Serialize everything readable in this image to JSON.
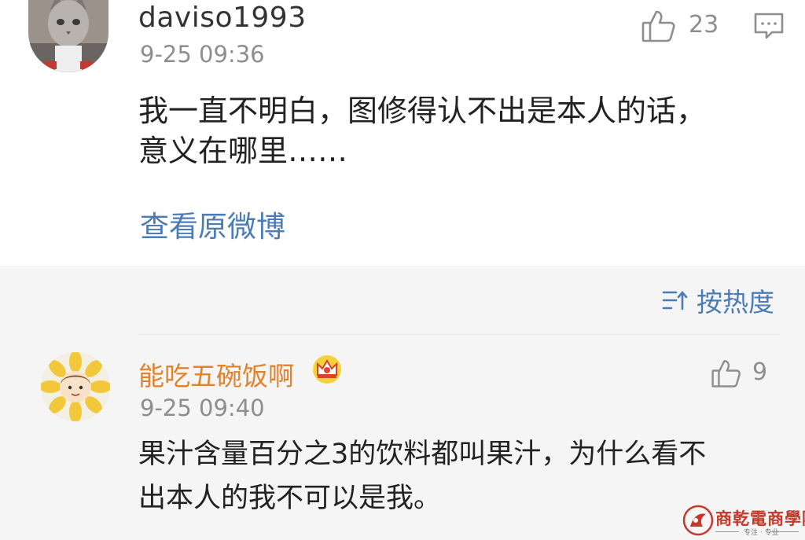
{
  "comment1": {
    "username": "daviso1993",
    "time": "9-25 09:36",
    "like_count": "23",
    "text_line1": "我一直不明白，图修得认不出是本人的话，",
    "text_line2": "意义在哪里……",
    "view_original": "查看原微博"
  },
  "sort": {
    "label": "按热度"
  },
  "comment2": {
    "username": "能吃五碗饭啊",
    "time": "9-25 09:40",
    "like_count": "9",
    "text_line1": "果汁含量百分之3的饮料都叫果汁，为什么看不",
    "text_line2": "出本人的我不可以是我。"
  },
  "watermark": {
    "title": "商乾電商學院",
    "subtitle": "专注 · 专业"
  },
  "colors": {
    "link": "#4c7cb5",
    "vip_name": "#e0832c",
    "meta": "#8e8e8e",
    "reply_bg": "#f5f5f5",
    "watermark": "#c5382c"
  },
  "icons": [
    "cat-avatar",
    "thumbs-up-icon",
    "comment-icon",
    "sort-icon",
    "sunflower-avatar",
    "crown-icon",
    "watermark-logo"
  ]
}
